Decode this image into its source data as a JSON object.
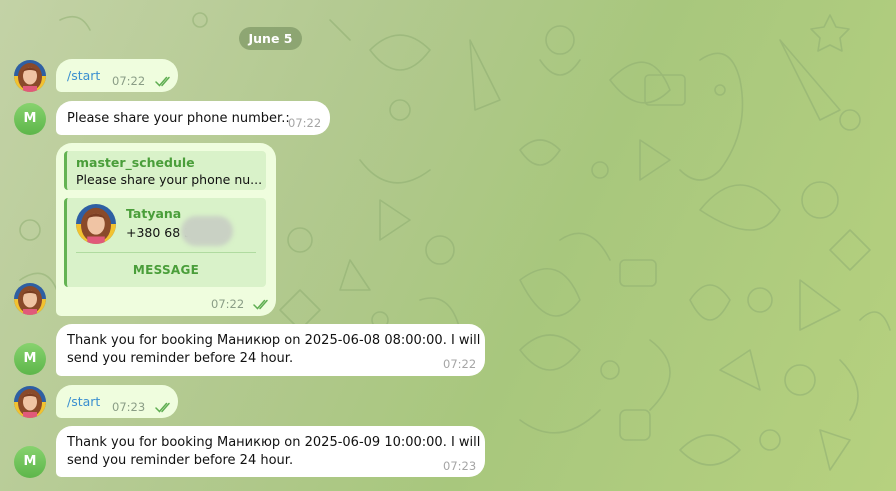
{
  "date_separator": "June 5",
  "bot_avatar_letter": "M",
  "messages": [
    {
      "type": "command",
      "text": "/start",
      "time": "07:22"
    },
    {
      "type": "bot",
      "text": "Please share your phone number.:",
      "time": "07:22"
    },
    {
      "type": "contact",
      "reply": {
        "name": "master_schedule",
        "text": "Please share your phone nu..."
      },
      "contact": {
        "name": "Tatyana",
        "phone": "+380 68 3",
        "button": "MESSAGE"
      },
      "time": "07:22"
    },
    {
      "type": "bot",
      "line1": "Thank you for booking Маникюр on 2025-06-08 08:00:00. I will",
      "line2": "send you reminder before 24 hour.",
      "time": "07:22"
    },
    {
      "type": "command",
      "text": "/start",
      "time": "07:23"
    },
    {
      "type": "bot",
      "line1": "Thank you for booking Маникюр on 2025-06-09 10:00:00. I will",
      "line2": "send you reminder before 24 hour.",
      "time": "07:23"
    }
  ],
  "colors": {
    "outgoing_bubble": "#effdde",
    "incoming_bubble": "#ffffff",
    "accent_green": "#4a9e3a",
    "command_link": "#3a8fd0",
    "read_ticks": "#5fae52"
  },
  "icons": {
    "read_receipt": "double-check-icon",
    "user_avatar": "user-avatar-photo",
    "bot_avatar": "bot-letter-avatar"
  }
}
